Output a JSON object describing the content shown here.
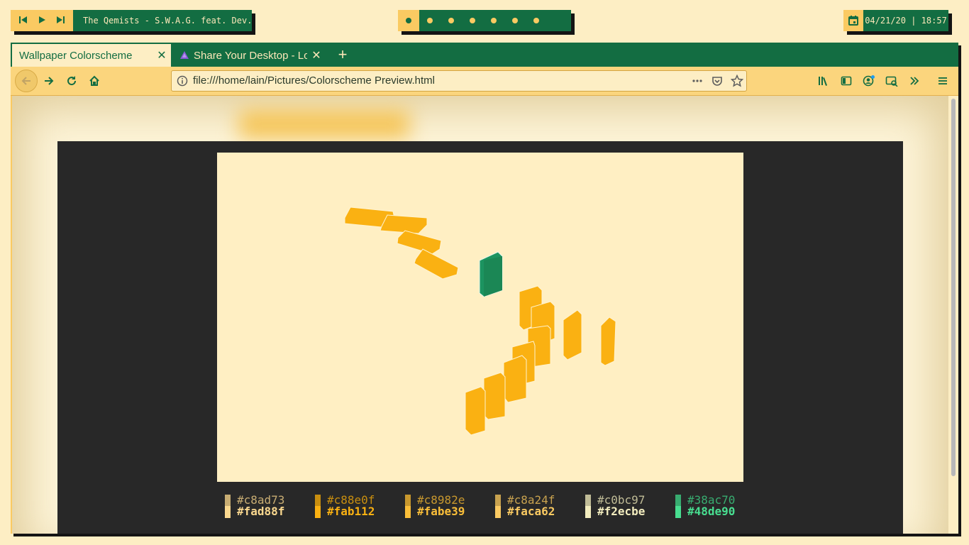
{
  "top_bar": {
    "player": {
      "prev_icon": "skip-previous-icon",
      "play_icon": "play-icon",
      "next_icon": "skip-next-icon",
      "track": "The Qemists - S.W.A.G. feat. Dev.."
    },
    "workspaces": {
      "count": 7,
      "active_index": 0
    },
    "clock": {
      "icon": "calendar-icon",
      "datetime": "04/21/20 | 18:57"
    }
  },
  "browser": {
    "tabs": [
      {
        "label": "Wallpaper Colorscheme",
        "active": true
      },
      {
        "label": "Share Your Desktop - Lou",
        "active": false
      }
    ],
    "url": "file:///home/lain/Pictures/Colorscheme Preview.html",
    "toolbar_icons": [
      "library-icon",
      "sidebar-icon",
      "account-icon",
      "screenshot-icon",
      "overflow-icon",
      "menu-icon"
    ]
  },
  "palette": [
    {
      "dim": "#c8ad73",
      "bright": "#fad88f"
    },
    {
      "dim": "#c88e0f",
      "bright": "#fab112"
    },
    {
      "dim": "#c8982e",
      "bright": "#fabe39"
    },
    {
      "dim": "#c8a24f",
      "bright": "#faca62"
    },
    {
      "dim": "#c0bc97",
      "bright": "#f2ecbe"
    },
    {
      "dim": "#38ac70",
      "bright": "#48de90"
    }
  ],
  "colors": {
    "accent_green": "#136d42",
    "accent_yellow": "#faca62",
    "page_bg": "#282828",
    "wallpaper_bg": "#ffefc3",
    "domino_yellow": "#fab112",
    "domino_green": "#1c9460"
  }
}
